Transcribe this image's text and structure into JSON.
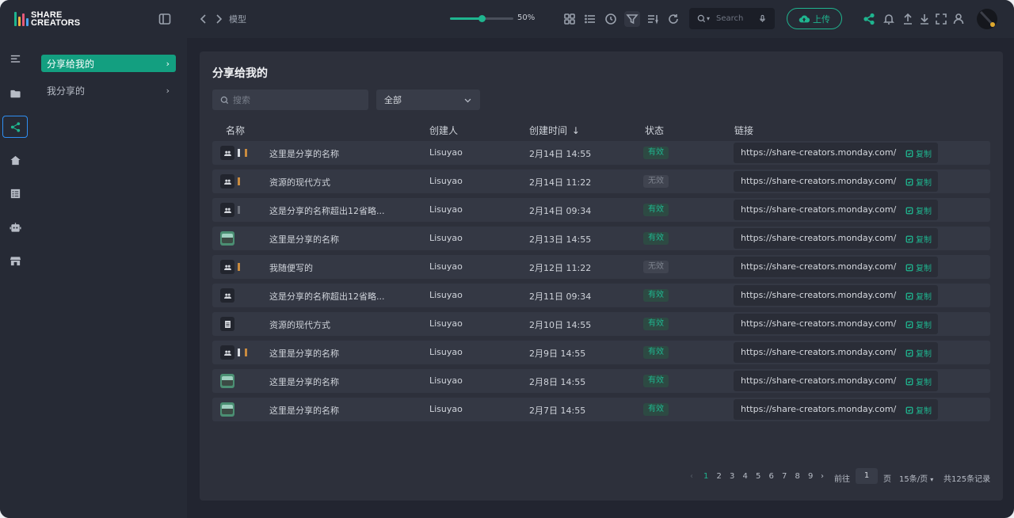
{
  "app": {
    "logo_line1": "SHARE",
    "logo_line2": "CREATORS"
  },
  "topbar": {
    "breadcrumb": "模型",
    "zoom_level": "50%",
    "zoom_fraction": 0.5,
    "search_placeholder": "Search",
    "upload_label": "上传",
    "icons": [
      "panel-toggle-icon",
      "back-icon",
      "forward-icon",
      "grid-view-icon",
      "list-view-icon",
      "history-icon",
      "filter-icon",
      "sort-icon",
      "refresh-icon",
      "search-icon",
      "mic-icon",
      "upload-cloud-icon",
      "share-icon",
      "bell-icon",
      "upload-icon",
      "download-icon",
      "fullscreen-icon",
      "user-icon"
    ]
  },
  "rail": {
    "items": [
      "menu-icon",
      "folder-icon",
      "share-icon",
      "home-icon",
      "list-icon",
      "robot-icon",
      "store-icon"
    ]
  },
  "subnav": {
    "items": [
      {
        "label": "分享给我的",
        "active": true
      },
      {
        "label": "我分享的",
        "active": false
      }
    ]
  },
  "panel": {
    "title": "分享给我的",
    "search_placeholder": "搜索",
    "filter_value": "全部",
    "columns": {
      "name": "名称",
      "creator": "创建人",
      "time": "创建时间",
      "status": "状态",
      "link": "链接"
    },
    "copy_label": "复制",
    "rows": [
      {
        "name": "这里是分享的名称",
        "creator": "Lisuyao",
        "time": "2月14日 14:55",
        "status": "有效",
        "valid": true,
        "link": "https://share-creators.monday.com/",
        "thumbs": "group"
      },
      {
        "name": "资源的现代方式",
        "creator": "Lisuyao",
        "time": "2月14日 11:22",
        "status": "无效",
        "valid": false,
        "link": "https://share-creators.monday.com/",
        "thumbs": "pair"
      },
      {
        "name": "这是分享的名称超出12省略...",
        "creator": "Lisuyao",
        "time": "2月14日 09:34",
        "status": "有效",
        "valid": true,
        "link": "https://share-creators.monday.com/",
        "thumbs": "pair-dim"
      },
      {
        "name": "这里是分享的名称",
        "creator": "Lisuyao",
        "time": "2月13日 14:55",
        "status": "有效",
        "valid": true,
        "link": "https://share-creators.monday.com/",
        "thumbs": "image"
      },
      {
        "name": "我随便写的",
        "creator": "Lisuyao",
        "time": "2月12日 11:22",
        "status": "无效",
        "valid": false,
        "link": "https://share-creators.monday.com/",
        "thumbs": "pair"
      },
      {
        "name": "这是分享的名称超出12省略...",
        "creator": "Lisuyao",
        "time": "2月11日 09:34",
        "status": "有效",
        "valid": true,
        "link": "https://share-creators.monday.com/",
        "thumbs": "single"
      },
      {
        "name": "资源的现代方式",
        "creator": "Lisuyao",
        "time": "2月10日 14:55",
        "status": "有效",
        "valid": true,
        "link": "https://share-creators.monday.com/",
        "thumbs": "doc"
      },
      {
        "name": "这里是分享的名称",
        "creator": "Lisuyao",
        "time": "2月9日 14:55",
        "status": "有效",
        "valid": true,
        "link": "https://share-creators.monday.com/",
        "thumbs": "group"
      },
      {
        "name": "这里是分享的名称",
        "creator": "Lisuyao",
        "time": "2月8日 14:55",
        "status": "有效",
        "valid": true,
        "link": "https://share-creators.monday.com/",
        "thumbs": "image"
      },
      {
        "name": "这里是分享的名称",
        "creator": "Lisuyao",
        "time": "2月7日 14:55",
        "status": "有效",
        "valid": true,
        "link": "https://share-creators.monday.com/",
        "thumbs": "image"
      }
    ]
  },
  "pagination": {
    "pages": [
      "1",
      "2",
      "3",
      "4",
      "5",
      "6",
      "7",
      "8",
      "9"
    ],
    "current": "1",
    "goto_label": "前往",
    "goto_value": "1",
    "page_label": "页",
    "page_size": "15条/页",
    "total": "共125条记录"
  },
  "colors": {
    "accent": "#1fb58f",
    "focus": "#2f8ff2",
    "bg": "#222530",
    "panel": "#2d303b"
  }
}
